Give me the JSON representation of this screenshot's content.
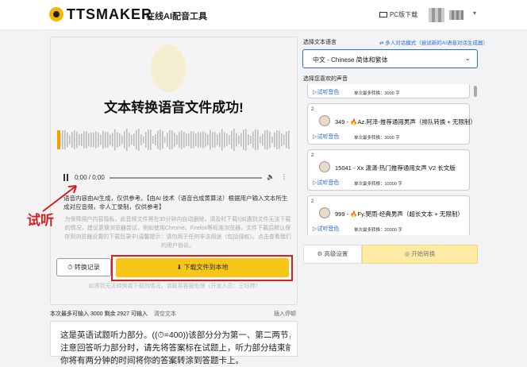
{
  "header": {
    "logo": "TTSMAKER",
    "slogan": "在线AI配音工具",
    "pc_download": "PC版下载"
  },
  "player": {
    "success_title": "文本转换语音文件成功!",
    "time": "0:00 / 0:00",
    "description": "语音内容由AI生成，仅供参考。【由AI 技术（语音合成黄算法）根据用户输入文本所生成对应音频，非人工录制，仅供参考】",
    "notice": "为保障用户内容隐私，此音频文件将在30分钟内自动删除，请及时下载!(如遇到文件无法下载的情况，建议更换浏览器尝试，例如使用Chrome、Firefox等标准浏览器，文件下载后默认保存到浏览器设置的下载目录中)温馨提示：请勿用于任何非法用途（包括侵权）。点击查看我们的用户协议。",
    "history_button": "转换记录",
    "download_button": "下载文件到本地",
    "reply_note": "如遇到无法转换或下载的情况，请联系客服处理（开发人员：王钰婷）"
  },
  "annotation": "试听",
  "text_input": {
    "count_label": "本次最多可输入 3000 剩余 2927 可输入",
    "clear_label": "清空文本",
    "insert_label": "插入停顿",
    "lines": [
      "这是英语试题听力部分。((⏱=400))该部分分为第一、第二两节，",
      "注意回答听力部分时，请先将答案标在试题上，听力部分结束前，",
      "你将有两分钟的时间将你的答案转涂到答题卡上。"
    ]
  },
  "voice_panel": {
    "language_label": "选择文本语言",
    "multi_mode_link": "多人对话模式（尝试新的AI语音对话生成器）",
    "language_value": "中文 - Chinese 简体和繁体",
    "voice_label": "选择您喜欢的声音",
    "voices": [
      {
        "id": "",
        "name": "",
        "try": "试听音色",
        "limit": "单次最多转换：3000 字"
      },
      {
        "id": "349",
        "name": "349 - 🔥Az.阿泽-推荐通用男声（排队转换 + 无限制）",
        "try": "试听音色",
        "limit": "单次最多转换：3000 字"
      },
      {
        "id": "15041",
        "name": "15041 - Xx 潇潇-热门推荐通用女声 V2 长文版",
        "try": "试听音色",
        "limit": "单次最多转换：10000 字"
      },
      {
        "id": "999",
        "name": "999 - 🔥Fy.樊雨-经典男声（超长文本 + 无限制）",
        "try": "试听音色",
        "limit": "单次最多转换：20000 字"
      }
    ],
    "advanced_button": "高级设置",
    "start_button": "开始转换"
  }
}
